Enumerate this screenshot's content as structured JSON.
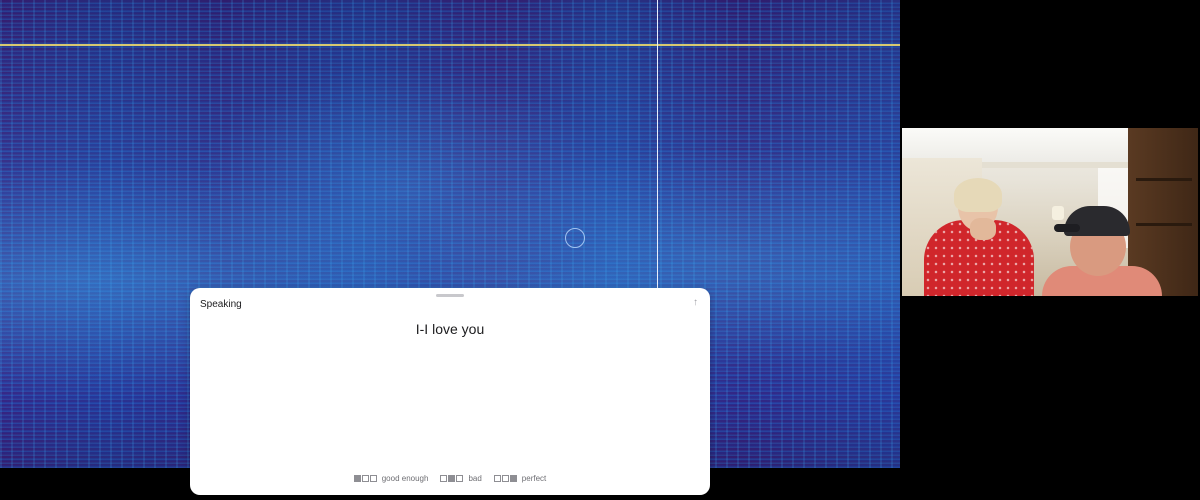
{
  "panel": {
    "title": "Speaking",
    "transcript": "I-I love you",
    "arrow_icon": "↑"
  },
  "feedback": [
    {
      "label": "good enough",
      "icon": "good-enough-icon"
    },
    {
      "label": "bad",
      "icon": "bad-icon"
    },
    {
      "label": "perfect",
      "icon": "perfect-icon"
    }
  ],
  "colors": {
    "spectrogram_base": "#3a1f7a",
    "spectrogram_highlight": "#50b4f0",
    "frequency_marker": "#d8c870",
    "playhead": "#e8eefc",
    "panel_bg": "#ffffff"
  }
}
